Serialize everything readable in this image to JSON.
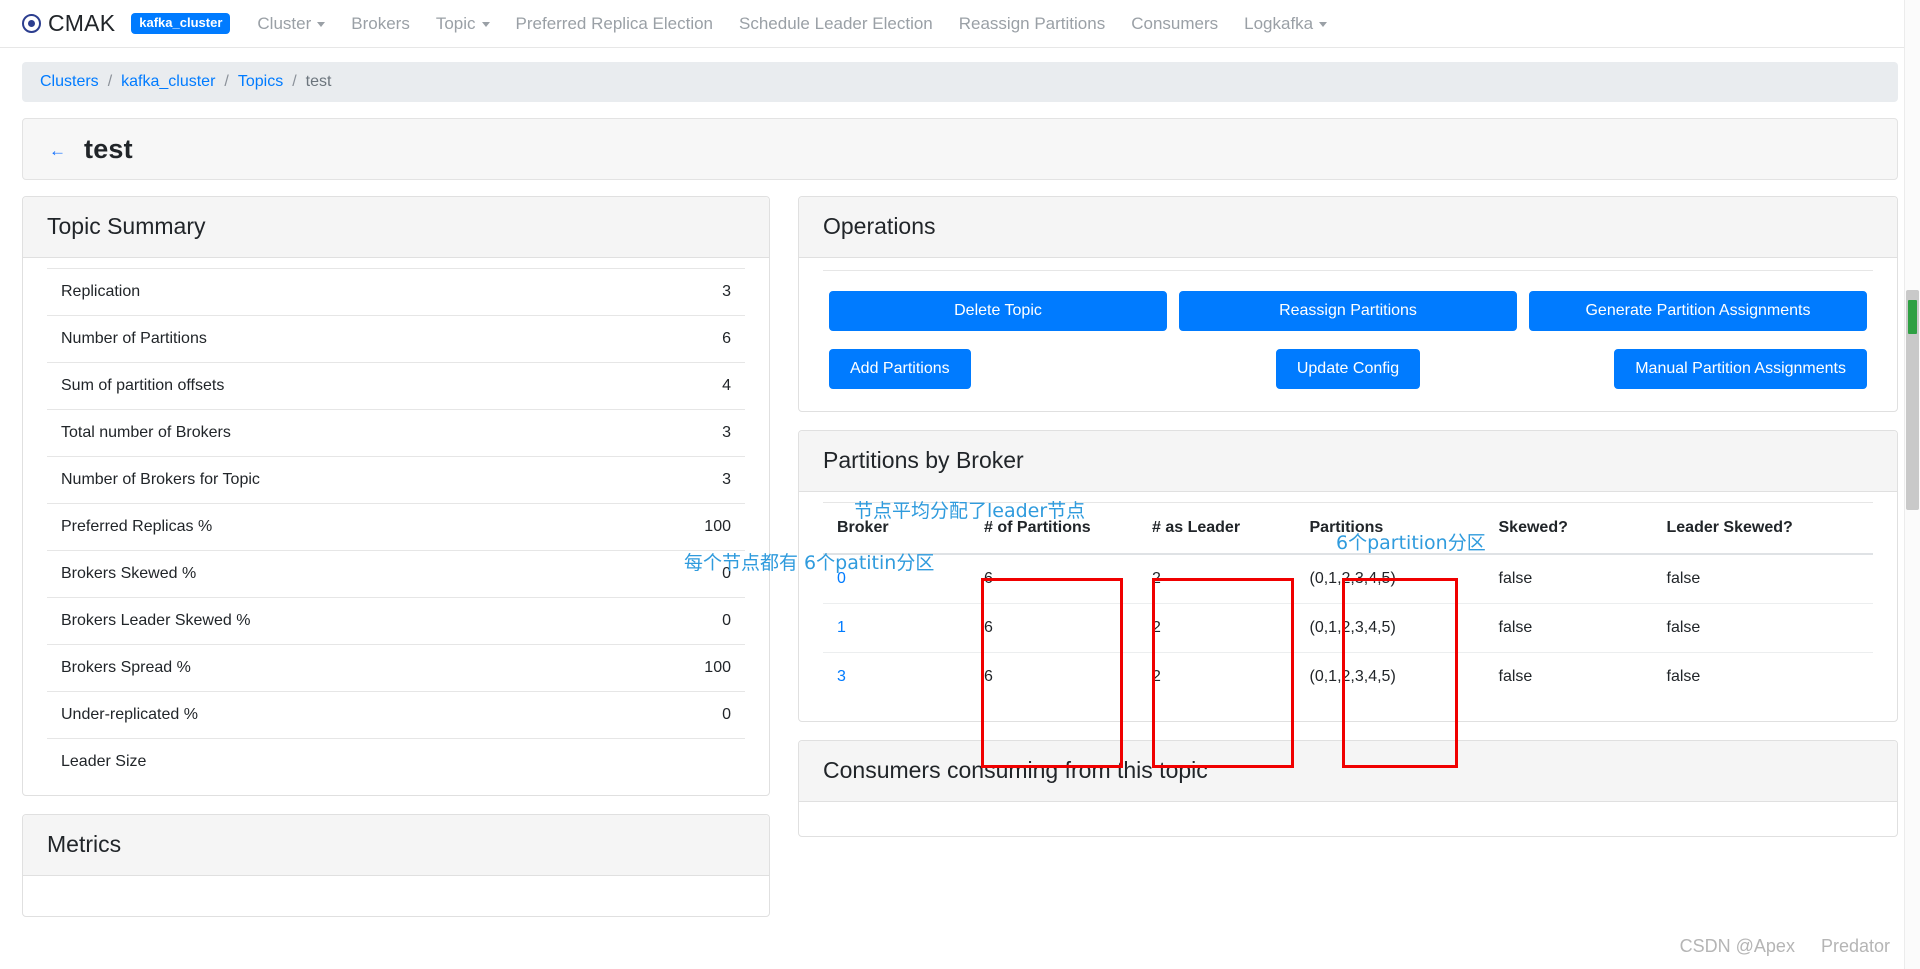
{
  "navbar": {
    "brand": "CMAK",
    "cluster_badge": "kafka_cluster",
    "items": [
      {
        "label": "Cluster",
        "caret": true
      },
      {
        "label": "Brokers",
        "caret": false
      },
      {
        "label": "Topic",
        "caret": true
      },
      {
        "label": "Preferred Replica Election",
        "caret": false
      },
      {
        "label": "Schedule Leader Election",
        "caret": false
      },
      {
        "label": "Reassign Partitions",
        "caret": false
      },
      {
        "label": "Consumers",
        "caret": false
      },
      {
        "label": "Logkafka",
        "caret": true
      }
    ]
  },
  "breadcrumb": {
    "items": [
      "Clusters",
      "kafka_cluster",
      "Topics",
      "test"
    ],
    "separator": "/"
  },
  "page": {
    "title": "test",
    "back_icon": "←"
  },
  "topic_summary": {
    "heading": "Topic Summary",
    "rows": [
      {
        "label": "Replication",
        "value": "3"
      },
      {
        "label": "Number of Partitions",
        "value": "6"
      },
      {
        "label": "Sum of partition offsets",
        "value": "4"
      },
      {
        "label": "Total number of Brokers",
        "value": "3"
      },
      {
        "label": "Number of Brokers for Topic",
        "value": "3"
      },
      {
        "label": "Preferred Replicas %",
        "value": "100"
      },
      {
        "label": "Brokers Skewed %",
        "value": "0"
      },
      {
        "label": "Brokers Leader Skewed %",
        "value": "0"
      },
      {
        "label": "Brokers Spread %",
        "value": "100"
      },
      {
        "label": "Under-replicated %",
        "value": "0"
      },
      {
        "label": "Leader Size",
        "value": ""
      }
    ]
  },
  "metrics": {
    "heading": "Metrics"
  },
  "operations": {
    "heading": "Operations",
    "row1": [
      "Delete Topic",
      "Reassign Partitions",
      "Generate Partition Assignments"
    ],
    "row2": [
      "Add Partitions",
      "Update Config",
      "Manual Partition Assignments"
    ]
  },
  "partitions_by_broker": {
    "heading": "Partitions by Broker",
    "columns": [
      "Broker",
      "# of Partitions",
      "# as Leader",
      "Partitions",
      "Skewed?",
      "Leader Skewed?"
    ],
    "rows": [
      {
        "broker": "0",
        "num_partitions": "6",
        "as_leader": "2",
        "partitions": "(0,1,2,3,4,5)",
        "skewed": "false",
        "leader_skewed": "false"
      },
      {
        "broker": "1",
        "num_partitions": "6",
        "as_leader": "2",
        "partitions": "(0,1,2,3,4,5)",
        "skewed": "false",
        "leader_skewed": "false"
      },
      {
        "broker": "3",
        "num_partitions": "6",
        "as_leader": "2",
        "partitions": "(0,1,2,3,4,5)",
        "skewed": "false",
        "leader_skewed": "false"
      }
    ]
  },
  "consumers": {
    "heading": "Consumers consuming from this topic"
  },
  "annotations": [
    {
      "text": "节点平均分配了leader节点"
    },
    {
      "text": "6个partition分区"
    },
    {
      "text": "每个节点都有 6个patitin分区"
    }
  ],
  "watermark": {
    "left": "CSDN @Apex",
    "right": "Predator"
  },
  "colors": {
    "primary": "#007bff",
    "link": "#007bff",
    "annotation": "#2f9bdd",
    "highlight_box": "#f00000"
  }
}
